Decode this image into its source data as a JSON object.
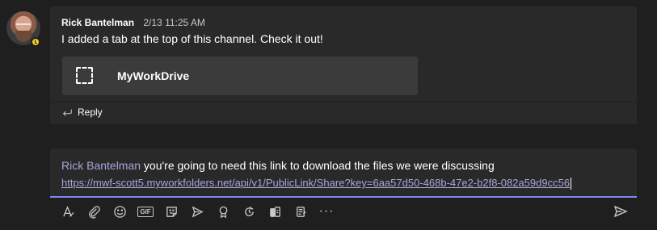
{
  "post": {
    "author": "Rick Bantelman",
    "time": "2/13 11:25 AM",
    "body": "I added a tab at the top of this channel. Check it out!",
    "card_title": "MyWorkDrive",
    "reply_label": "Reply",
    "avatar_status": "away"
  },
  "compose": {
    "mention": "Rick Bantelman",
    "text": " you're going to need this link to download the files we were discussing",
    "link": "https://mwf-scott5.myworkfolders.net/api/v1/PublicLink/Share?key=6aa57d50-468b-47e2-b2f8-082a59d9cc56"
  },
  "toolbar": {
    "icons": [
      "format-icon",
      "attach-icon",
      "emoji-icon",
      "gif-icon",
      "sticker-icon",
      "meet-now-icon",
      "praise-icon",
      "loop-icon",
      "stream-icon",
      "forms-icon",
      "more-options-icon",
      "send-icon"
    ],
    "gif_label": "GIF",
    "more_label": "···"
  },
  "colors": {
    "background": "#1f1f1f",
    "card": "#292929",
    "accent": "#7f85f5",
    "mention": "#a6a7dc",
    "status_away": "#f8d22a"
  }
}
